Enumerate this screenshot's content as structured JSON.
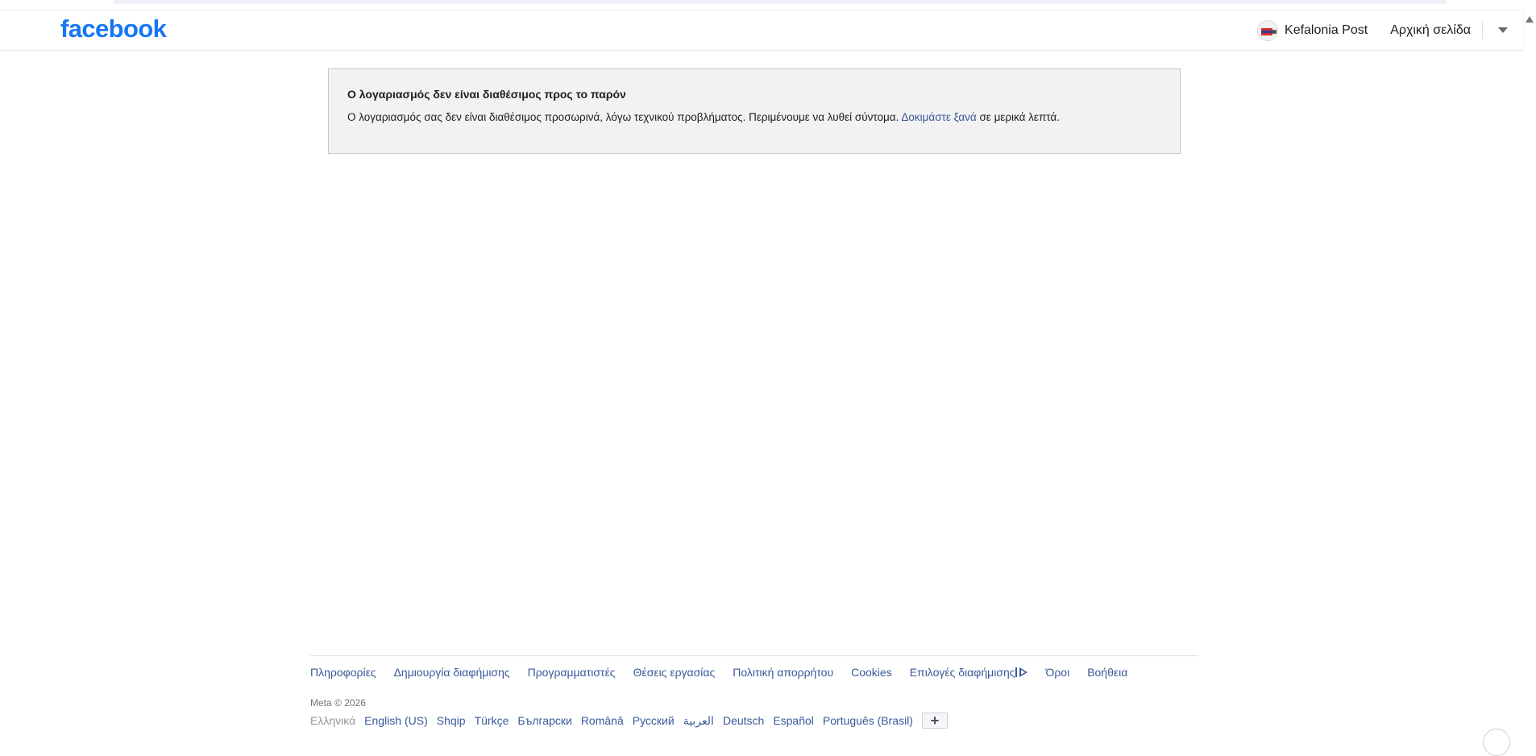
{
  "header": {
    "logo_text": "facebook",
    "page_name": "Kefalonia Post",
    "home_label": "Αρχική σελίδα"
  },
  "notice": {
    "title": "Ο λογαριασμός δεν είναι διαθέσιμος προς το παρόν",
    "body_before": "Ο λογαριασμός σας δεν είναι διαθέσιμος προσωρινά, λόγω τεχνικού προβλήματος. Περιμένουμε να λυθεί σύντομα.",
    "retry_link": "Δοκιμάστε ξανά",
    "body_after": "σε μερικά λεπτά."
  },
  "footer": {
    "links": [
      "Πληροφορίες",
      "Δημιουργία διαφήμισης",
      "Προγραμματιστές",
      "Θέσεις εργασίας",
      "Πολιτική απορρήτου",
      "Cookies",
      "Επιλογές διαφήμισης",
      "Όροι",
      "Βοήθεια"
    ],
    "copyright": "Meta © 2026",
    "current_language": "Ελληνικά",
    "languages": [
      "English (US)",
      "Shqip",
      "Türkçe",
      "Български",
      "Română",
      "Русский",
      "العربية",
      "Deutsch",
      "Español",
      "Português (Brasil)"
    ],
    "add_language": "+"
  },
  "colors": {
    "brand": "#1877f2",
    "link": "#385898",
    "notice_bg": "#f2f2f2"
  },
  "icons": {
    "page_avatar": "flag-avatar-icon",
    "menu": "caret-down-icon",
    "ad_choices": "ad-choices-icon"
  }
}
